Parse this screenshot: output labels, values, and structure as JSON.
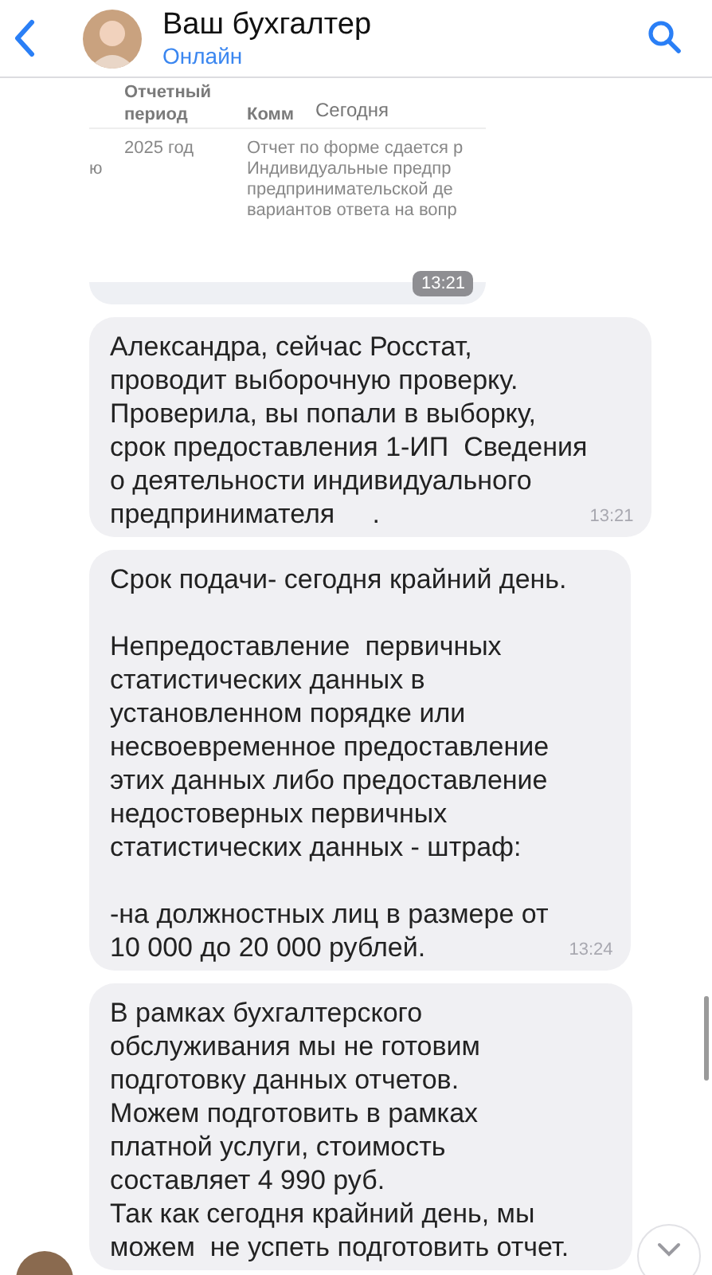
{
  "header": {
    "title": "Ваш бухгалтер",
    "status": "Онлайн"
  },
  "date_badge": "Сегодня",
  "messages": [
    {
      "kind": "image",
      "table": {
        "columns": [
          "Отчетный\nпериод",
          "Комм"
        ],
        "row": {
          "column_1": "ю",
          "period": "2025 год",
          "comment": "Отчет по форме сдается р\nИндивидуальные предпр\nпредпринимательской де\nвариантов ответа на вопр"
        }
      },
      "time": "13:21"
    },
    {
      "kind": "text",
      "text": "Александра, сейчас Росстат,\nпроводит выборочную проверку.\nПроверила, вы попали в выборку,\nсрок предоставления 1-ИП  Сведения\nо деятельности индивидуального\nпредпринимателя     .",
      "time": "13:21"
    },
    {
      "kind": "text",
      "text": "Срок подачи- сегодня крайний день.\n\nНепредоставление  первичных\nстатистических данных в\nустановленном порядке или\nнесвоевременное предоставление\nэтих данных либо предоставление\nнедостоверных первичных\nстатистических данных - штраф:\n\n-на должностных лиц в размере от\n10 000 до 20 000 рублей.",
      "time": "13:24"
    },
    {
      "kind": "text",
      "text": "В рамках бухгалтерского\nобслуживания мы не готовим\nподготовку данных отчетов.\nМожем подготовить в рамках\nплатной услуги, стоимость\nсоставляет 4 990 руб.\nТак как сегодня крайний день, мы\nможем  не успеть подготовить отчет."
    }
  ]
}
